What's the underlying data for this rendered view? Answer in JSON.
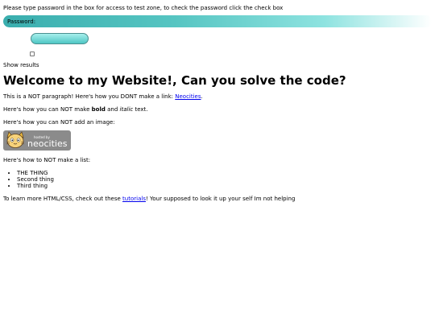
{
  "intro_text": "Please type password in the box for access to test zone, to check the password click the check box",
  "password_label": "Password:",
  "show_results": "Show results",
  "heading": "Welcome to my Website!, Can you solve the code?",
  "para1": {
    "before": "This is a NOT paragraph! Here's how you DONT make a link: ",
    "link": "Neocities",
    "after": "."
  },
  "para2": {
    "before": "Here's how you can NOT make ",
    "bold": "bold",
    "middle": " and ",
    "italic": "italic",
    "after": " text."
  },
  "para3": "Here's how you can NOT add an image:",
  "badge": {
    "small": "hosted by",
    "big": "neocities"
  },
  "para4": "Here's how to NOT make a list:",
  "list_items": [
    "THE THING",
    "Second thing",
    "Third thing"
  ],
  "para5": {
    "before": "To learn more HTML/CSS, check out these ",
    "link": "tutorials",
    "after": "! Your supposed to look it up your self Im not helping"
  }
}
